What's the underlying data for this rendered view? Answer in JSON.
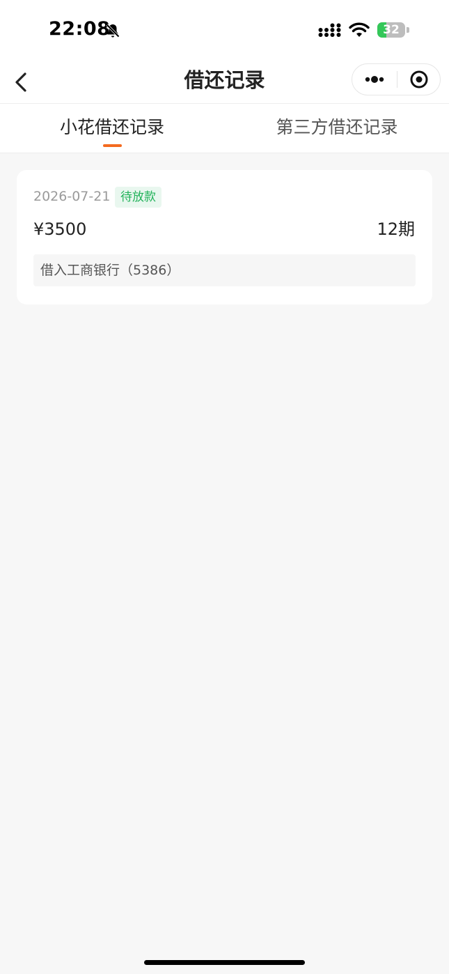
{
  "status_bar": {
    "time": "22:08",
    "battery_level": "32",
    "battery_fraction": 0.32,
    "icons": [
      "bell-off-icon",
      "signal-icon",
      "wifi-icon",
      "battery-icon"
    ]
  },
  "nav": {
    "title": "借还记录",
    "back_icon": "chevron-left-icon",
    "more_icon": "more-dots-icon",
    "close_icon": "target-close-icon"
  },
  "tabs": [
    {
      "label": "小花借还记录",
      "active": true
    },
    {
      "label": "第三方借还记录",
      "active": false
    }
  ],
  "accent_color": "#f46a1f",
  "records": [
    {
      "date": "2026-07-21",
      "status": "待放款",
      "status_color": "#22b25a",
      "amount": "¥3500",
      "periods": "12期",
      "bank": "借入工商银行（5386）"
    }
  ]
}
